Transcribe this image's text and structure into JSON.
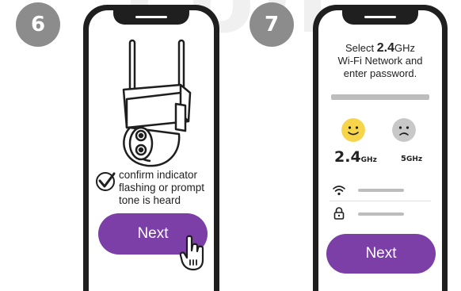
{
  "steps": [
    {
      "number": "6",
      "confirm_text": "confirm indicator flashing or prompt tone is heard",
      "next_label": "Next"
    },
    {
      "number": "7",
      "instruction": {
        "line1_prefix": "Select ",
        "frequency": "2.4",
        "frequency_unit": "GHz",
        "line2": "Wi-Fi Network and",
        "line3": "enter password."
      },
      "band_supported": {
        "value": "2.4",
        "unit": "GHz"
      },
      "band_unsupported": {
        "value": "5",
        "unit": "GHz"
      },
      "next_label": "Next"
    }
  ],
  "icons": {
    "watermark": "watermark-graphic",
    "camera": "security-camera-illustration",
    "check": "checkmark-icon",
    "pointer": "hand-pointer-icon",
    "happy": "happy-face-icon",
    "sad": "sad-face-icon",
    "wifi": "wifi-icon",
    "lock": "lock-icon"
  },
  "colors": {
    "accent": "#7b3fa7",
    "badge": "#8c8c8c",
    "happy_face": "#f7d54a",
    "sad_face": "#c8c8c8",
    "phone_frame": "#1f1f1f"
  }
}
